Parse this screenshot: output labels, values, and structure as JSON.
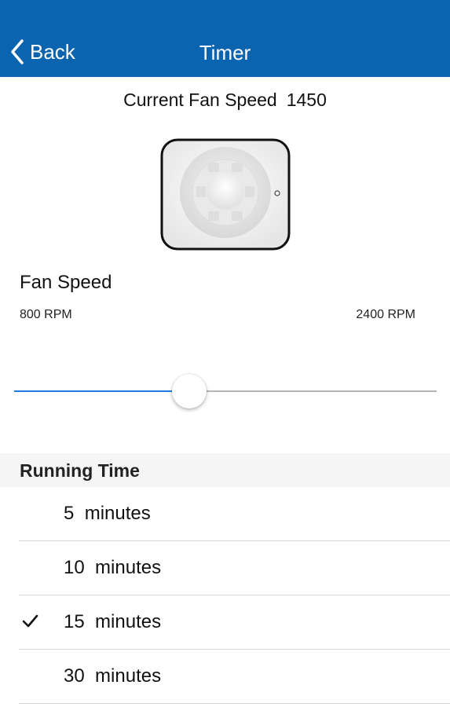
{
  "nav": {
    "back_label": "Back",
    "title": "Timer"
  },
  "status": {
    "current_speed_label": "Current Fan Speed",
    "current_speed_value": "1450"
  },
  "fan_speed": {
    "label": "Fan Speed",
    "min_label": "800 RPM",
    "max_label": "2400 RPM",
    "slider_fraction": 0.415
  },
  "running_time": {
    "title": "Running Time",
    "options": [
      {
        "value": "5",
        "unit": "minutes",
        "selected": false
      },
      {
        "value": "10",
        "unit": "minutes",
        "selected": false
      },
      {
        "value": "15",
        "unit": "minutes",
        "selected": true
      },
      {
        "value": "30",
        "unit": "minutes",
        "selected": false
      }
    ]
  },
  "colors": {
    "nav_bar": "#0a64b0",
    "slider_fill": "#1e7be2",
    "slider_track": "#b5b5b5"
  },
  "icons": {
    "back": "chevron-left-icon",
    "selected": "checkmark-icon",
    "fan": "extractor-fan-icon"
  }
}
